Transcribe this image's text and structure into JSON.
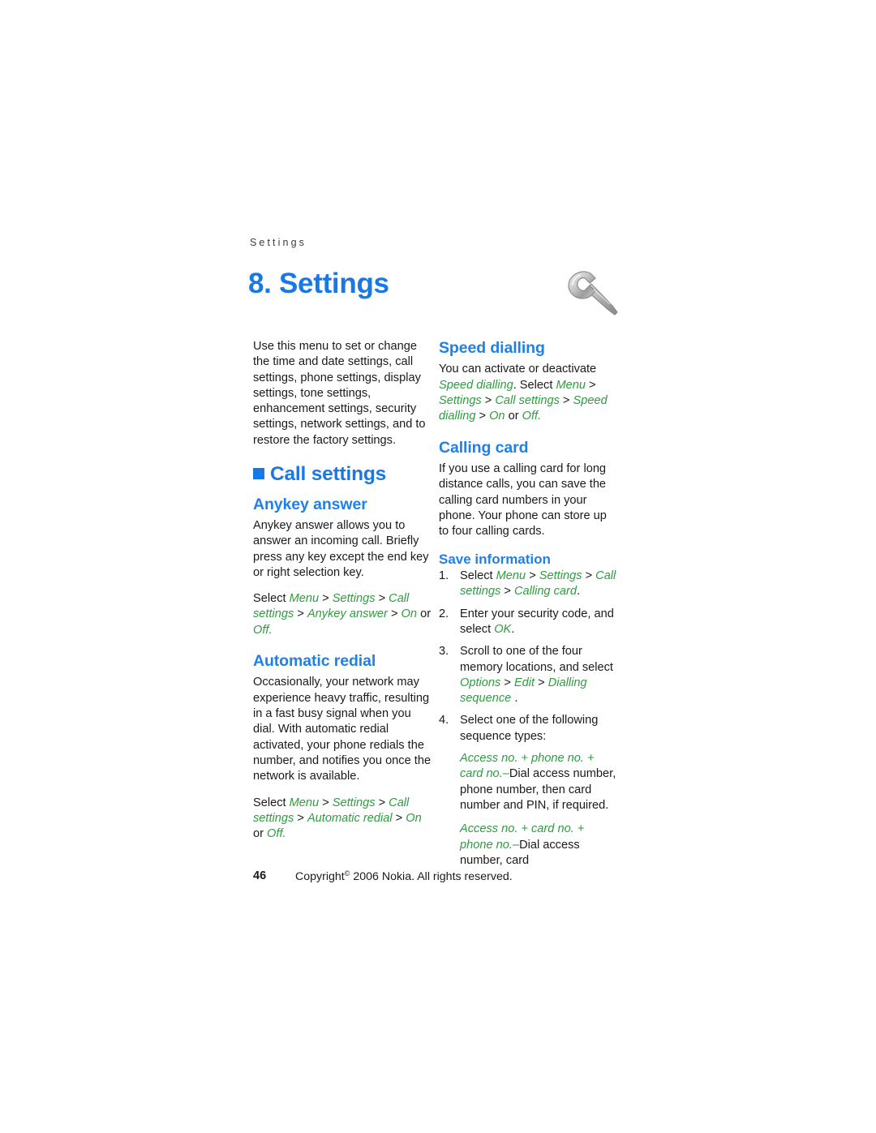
{
  "page": {
    "running_head": "Settings",
    "chapter_title": "8. Settings",
    "chapter_icon": "wrench-icon",
    "folio": "46",
    "copyright": "Copyright © 2006 Nokia. All rights reserved.",
    "copyright_prefix": "Copyright",
    "copyright_suffix": "2006 Nokia. All rights reserved.",
    "accent_blue": "#1878e6",
    "accent_green": "#2f9c3f",
    "body_color": "#1a1a1a"
  },
  "left_column": {
    "intro": "Use this menu to set or change the time and date settings, call settings, phone settings, display settings, tone settings, enhancement settings, security settings, network settings, and to restore the factory settings.",
    "section_heading": "Call settings",
    "anykey": {
      "heading": "Anykey answer",
      "body": "Anykey answer allows you to answer an incoming call. Briefly press any key except the end key or right selection key.",
      "path": {
        "lead": "Select",
        "items": [
          "Menu",
          "Settings",
          "Call settings",
          "Anykey answer",
          "On"
        ],
        "conjunction": "or",
        "last": "Off",
        "terminator": "."
      }
    },
    "automatic_redial": {
      "heading": "Automatic redial",
      "body": "Occasionally, your network may experience heavy traffic, resulting in a fast busy signal when you dial. With automatic redial activated, your phone redials the number, and notifies you once the network is available.",
      "path": {
        "lead": "Select",
        "items": [
          "Menu",
          "Settings",
          "Call settings",
          "Automatic redial",
          "On"
        ],
        "conjunction": "or",
        "last": "Off",
        "terminator": "."
      }
    }
  },
  "right_column": {
    "speed_dialling": {
      "heading": "Speed dialling",
      "body_lead": "You can activate or deactivate",
      "body_term": "Speed dialling",
      "body_mid": ". Select",
      "path_items": [
        "Menu",
        "Settings",
        "Call settings",
        "Speed dialling",
        "On"
      ],
      "conjunction": "or",
      "last": "Off",
      "terminator": "."
    },
    "calling_card": {
      "heading": "Calling card",
      "body": "If you use a calling card for long distance calls, you can save the calling card numbers in your phone. Your phone can store up to four calling cards.",
      "save_information": {
        "heading": "Save information",
        "steps": [
          {
            "lead": "Select",
            "items": [
              "Menu",
              "Settings",
              "Call settings",
              "Calling card"
            ],
            "terminator": "."
          },
          {
            "text_before": "Enter your security code, and select",
            "term": "OK",
            "terminator": "."
          },
          {
            "text_before": "Scroll to one of the four memory locations, and select",
            "items": [
              "Options",
              "Edit",
              "Dialling sequence"
            ],
            "terminator": "."
          },
          {
            "text_before": "Select one of the following sequence types:"
          }
        ],
        "definitions": [
          {
            "term": "Access no. + phone no. + card no.",
            "dash": "–",
            "definition": "Dial access number, phone number, then card number and PIN, if required."
          },
          {
            "term": "Access no. + card no. + phone no.",
            "dash": "–",
            "definition": "Dial access number, card"
          }
        ]
      }
    }
  }
}
